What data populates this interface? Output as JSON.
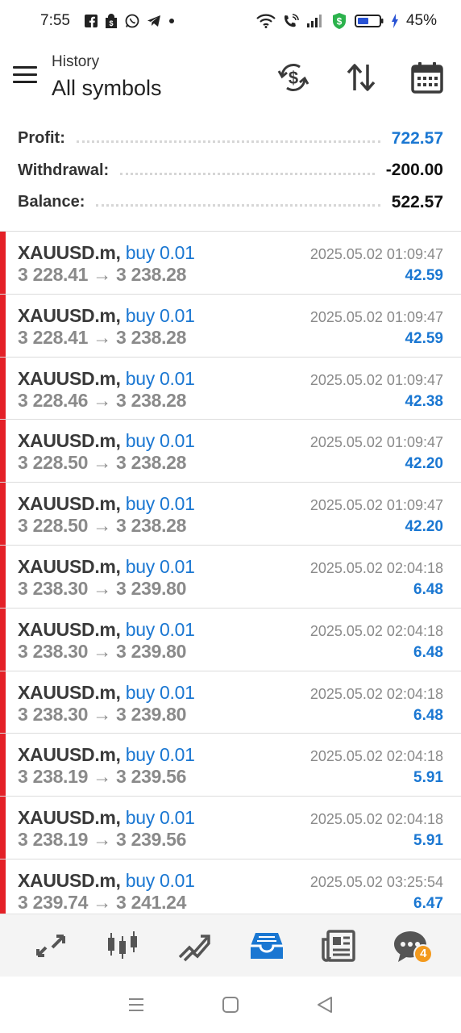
{
  "status_bar": {
    "time": "7:55",
    "battery_percent": "45%",
    "left_icons": [
      "facebook-icon",
      "shopping-bag-icon",
      "whatsapp-icon",
      "telegram-icon",
      "dot-icon"
    ],
    "right_icons": [
      "wifi-icon",
      "wifi-call-icon",
      "signal-icon",
      "money-shield-icon",
      "battery-icon",
      "charging-icon"
    ]
  },
  "header": {
    "subtitle": "History",
    "title": "All symbols",
    "actions": [
      "currency-exchange-icon",
      "sort-icon",
      "calendar-icon"
    ]
  },
  "summary": {
    "profit_label": "Profit:",
    "profit_value": "722.57",
    "withdrawal_label": "Withdrawal:",
    "withdrawal_value": "-200.00",
    "balance_label": "Balance:",
    "balance_value": "522.57"
  },
  "trades": [
    {
      "symbol": "XAUUSD.m,",
      "direction": "buy 0.01",
      "open": "3 228.41",
      "arrow": "→",
      "close": "3 238.28",
      "time": "2025.05.02 01:09:47",
      "profit": "42.59"
    },
    {
      "symbol": "XAUUSD.m,",
      "direction": "buy 0.01",
      "open": "3 228.41",
      "arrow": "→",
      "close": "3 238.28",
      "time": "2025.05.02 01:09:47",
      "profit": "42.59"
    },
    {
      "symbol": "XAUUSD.m,",
      "direction": "buy 0.01",
      "open": "3 228.46",
      "arrow": "→",
      "close": "3 238.28",
      "time": "2025.05.02 01:09:47",
      "profit": "42.38"
    },
    {
      "symbol": "XAUUSD.m,",
      "direction": "buy 0.01",
      "open": "3 228.50",
      "arrow": "→",
      "close": "3 238.28",
      "time": "2025.05.02 01:09:47",
      "profit": "42.20"
    },
    {
      "symbol": "XAUUSD.m,",
      "direction": "buy 0.01",
      "open": "3 228.50",
      "arrow": "→",
      "close": "3 238.28",
      "time": "2025.05.02 01:09:47",
      "profit": "42.20"
    },
    {
      "symbol": "XAUUSD.m,",
      "direction": "buy 0.01",
      "open": "3 238.30",
      "arrow": "→",
      "close": "3 239.80",
      "time": "2025.05.02 02:04:18",
      "profit": "6.48"
    },
    {
      "symbol": "XAUUSD.m,",
      "direction": "buy 0.01",
      "open": "3 238.30",
      "arrow": "→",
      "close": "3 239.80",
      "time": "2025.05.02 02:04:18",
      "profit": "6.48"
    },
    {
      "symbol": "XAUUSD.m,",
      "direction": "buy 0.01",
      "open": "3 238.30",
      "arrow": "→",
      "close": "3 239.80",
      "time": "2025.05.02 02:04:18",
      "profit": "6.48"
    },
    {
      "symbol": "XAUUSD.m,",
      "direction": "buy 0.01",
      "open": "3 238.19",
      "arrow": "→",
      "close": "3 239.56",
      "time": "2025.05.02 02:04:18",
      "profit": "5.91"
    },
    {
      "symbol": "XAUUSD.m,",
      "direction": "buy 0.01",
      "open": "3 238.19",
      "arrow": "→",
      "close": "3 239.56",
      "time": "2025.05.02 02:04:18",
      "profit": "5.91"
    },
    {
      "symbol": "XAUUSD.m,",
      "direction": "buy 0.01",
      "open": "3 239.74",
      "arrow": "→",
      "close": "3 241.24",
      "time": "2025.05.02 03:25:54",
      "profit": "6.47"
    }
  ],
  "bottom_nav": {
    "items": [
      "quotes-icon",
      "chart-icon",
      "trade-icon",
      "history-icon",
      "news-icon",
      "messages-icon"
    ],
    "active": "history-icon",
    "messages_badge": "4"
  },
  "system_nav": [
    "recent-apps-icon",
    "home-icon",
    "back-icon"
  ],
  "colors": {
    "accent_blue": "#1a77d2",
    "buy_bar_red": "#e42027",
    "badge_orange": "#f39a1e"
  }
}
